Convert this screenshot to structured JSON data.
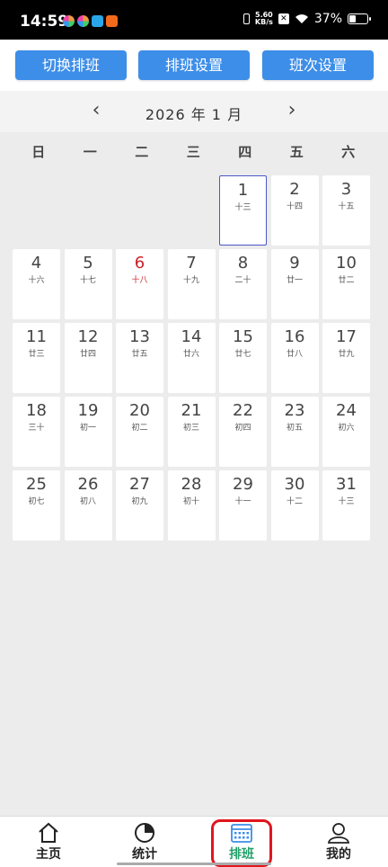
{
  "status_bar": {
    "time": "14:59",
    "net_speed_top": "5.60",
    "net_speed_bottom": "KB/s",
    "battery": "37%",
    "battery_level": 0.37
  },
  "toolbar": {
    "switch_label": "切换排班",
    "settings_label": "排班设置",
    "shift_label": "班次设置"
  },
  "month_nav": {
    "title": "2026 年 1 月",
    "prev_icon": "chevron-left-icon",
    "next_icon": "chevron-right-icon"
  },
  "weekdays": [
    "日",
    "一",
    "二",
    "三",
    "四",
    "五",
    "六"
  ],
  "days": [
    {
      "day": "1",
      "lunar": "十三",
      "today": true
    },
    {
      "day": "2",
      "lunar": "十四"
    },
    {
      "day": "3",
      "lunar": "十五"
    },
    {
      "day": "4",
      "lunar": "十六"
    },
    {
      "day": "5",
      "lunar": "十七"
    },
    {
      "day": "6",
      "lunar": "十八",
      "red": true
    },
    {
      "day": "7",
      "lunar": "十九"
    },
    {
      "day": "8",
      "lunar": "二十"
    },
    {
      "day": "9",
      "lunar": "廿一"
    },
    {
      "day": "10",
      "lunar": "廿二"
    },
    {
      "day": "11",
      "lunar": "廿三"
    },
    {
      "day": "12",
      "lunar": "廿四"
    },
    {
      "day": "13",
      "lunar": "廿五"
    },
    {
      "day": "14",
      "lunar": "廿六"
    },
    {
      "day": "15",
      "lunar": "廿七"
    },
    {
      "day": "16",
      "lunar": "廿八"
    },
    {
      "day": "17",
      "lunar": "廿九"
    },
    {
      "day": "18",
      "lunar": "三十"
    },
    {
      "day": "19",
      "lunar": "初一"
    },
    {
      "day": "20",
      "lunar": "初二"
    },
    {
      "day": "21",
      "lunar": "初三"
    },
    {
      "day": "22",
      "lunar": "初四"
    },
    {
      "day": "23",
      "lunar": "初五"
    },
    {
      "day": "24",
      "lunar": "初六"
    },
    {
      "day": "25",
      "lunar": "初七"
    },
    {
      "day": "26",
      "lunar": "初八"
    },
    {
      "day": "27",
      "lunar": "初九"
    },
    {
      "day": "28",
      "lunar": "初十"
    },
    {
      "day": "29",
      "lunar": "十一"
    },
    {
      "day": "30",
      "lunar": "十二"
    },
    {
      "day": "31",
      "lunar": "十三"
    }
  ],
  "first_weekday_index": 4,
  "bottom_nav": {
    "home": "主页",
    "stats": "统计",
    "schedule": "排班",
    "mine": "我的",
    "active": "schedule"
  },
  "colors": {
    "accent_button": "#3d8ee8",
    "active_tab": "#23a06a",
    "today_border": "#4a57c8",
    "holiday_red": "#c8232a",
    "highlight_box": "#e0161e"
  }
}
